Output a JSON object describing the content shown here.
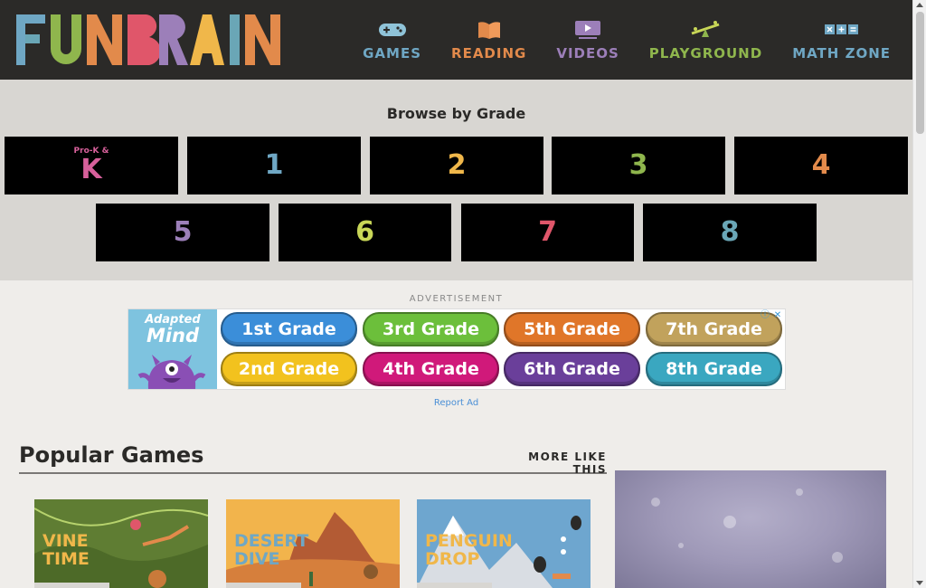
{
  "logo": {
    "text": "FUNBRAIN",
    "letters": [
      {
        "ch": "F",
        "color": "#6fa7c4"
      },
      {
        "ch": "U",
        "color": "#8fb64d"
      },
      {
        "ch": "N",
        "color": "#e28a4b"
      },
      {
        "ch": "B",
        "color": "#e0566a"
      },
      {
        "ch": "R",
        "color": "#9c7fb9"
      },
      {
        "ch": "A",
        "color": "#f0b74a"
      },
      {
        "ch": "I",
        "color": "#6aa6b6"
      },
      {
        "ch": "N",
        "color": "#e28a4b"
      }
    ]
  },
  "nav": [
    {
      "label": "GAMES",
      "color": "#6fa7c4",
      "icon": "gamepad-icon"
    },
    {
      "label": "READING",
      "color": "#e28a4b",
      "icon": "book-icon"
    },
    {
      "label": "VIDEOS",
      "color": "#9c7fb9",
      "icon": "video-icon"
    },
    {
      "label": "PLAYGROUND",
      "color": "#8fb64d",
      "icon": "seesaw-icon"
    },
    {
      "label": "MATH ZONE",
      "color": "#6fa7c4",
      "icon": "math-icon"
    }
  ],
  "grades": {
    "title": "Browse by Grade",
    "items": [
      {
        "pre": "Pro-K &",
        "label": "K",
        "color": "#d7609b"
      },
      {
        "label": "1",
        "color": "#6fa7c4"
      },
      {
        "label": "2",
        "color": "#f0b74a"
      },
      {
        "label": "3",
        "color": "#8fb64d"
      },
      {
        "label": "4",
        "color": "#e28a4b"
      },
      {
        "label": "5",
        "color": "#9c7fb9"
      },
      {
        "label": "6",
        "color": "#c8d657"
      },
      {
        "label": "7",
        "color": "#e0566a"
      },
      {
        "label": "8",
        "color": "#6aa6b6"
      }
    ]
  },
  "ad": {
    "label": "ADVERTISEMENT",
    "brand_line1": "Adapted",
    "brand_line2": "Mind",
    "pills": [
      {
        "label": "1st Grade",
        "color": "#3b8ed9"
      },
      {
        "label": "3rd Grade",
        "color": "#6cbf3b"
      },
      {
        "label": "5th Grade",
        "color": "#e07629"
      },
      {
        "label": "7th Grade",
        "color": "#c1a25c"
      },
      {
        "label": "2nd Grade",
        "color": "#f2c21e"
      },
      {
        "label": "4th Grade",
        "color": "#d0197a"
      },
      {
        "label": "6th Grade",
        "color": "#6a3f9a"
      },
      {
        "label": "8th Grade",
        "color": "#3aa7c0"
      }
    ],
    "info_icon": "ⓘ",
    "close_icon": "✕",
    "report": "Report Ad"
  },
  "popular": {
    "title": "Popular Games",
    "more": "MORE LIKE THIS",
    "games": [
      {
        "title_line1": "VINE",
        "title_line2": "TIME",
        "title_color": "#f0b74a"
      },
      {
        "title_line1": "DESERT",
        "title_line2": "DIVE",
        "title_color": "#6fa7c4"
      },
      {
        "title_line1": "PENGUIN",
        "title_line2": "DROP",
        "title_color": "#f0b74a"
      }
    ]
  }
}
